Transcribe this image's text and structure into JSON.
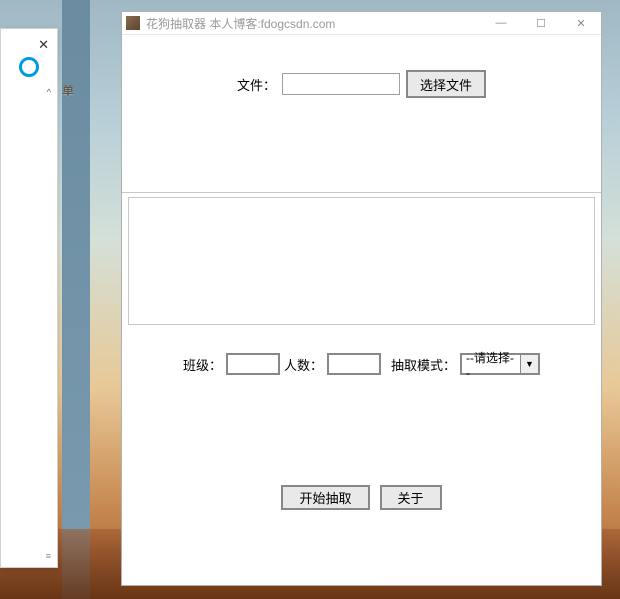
{
  "bg_label": "单",
  "left_panel": {
    "close": "✕",
    "chevron": "^",
    "menu": "≡"
  },
  "window": {
    "title": "花狗抽取器   本人博客:fdogcsdn.com",
    "controls": {
      "min": "—",
      "max": "☐",
      "close": "✕"
    }
  },
  "file_row": {
    "label": "文件：",
    "value": "",
    "pick_btn": "选择文件"
  },
  "opts": {
    "class_label": "班级：",
    "class_value": "",
    "count_label": "人数：",
    "count_value": "",
    "mode_label": "抽取模式：",
    "mode_value": "--请选择--",
    "mode_arrow": "▼"
  },
  "actions": {
    "start": "开始抽取",
    "about": "关于"
  }
}
